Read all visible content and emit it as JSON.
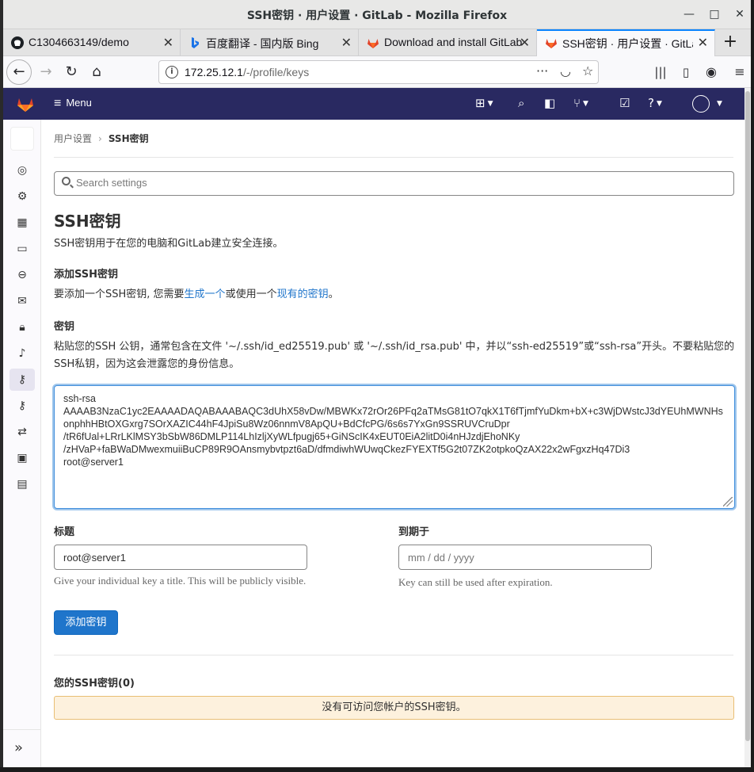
{
  "window": {
    "title": "SSH密钥 · 用户设置 · GitLab - Mozilla Firefox"
  },
  "tabs": [
    {
      "label": "C1304663149/demo",
      "icon": "github-icon"
    },
    {
      "label": "百度翻译 - 国内版 Bing",
      "icon": "bing-icon"
    },
    {
      "label": "Download and install GitLab",
      "icon": "gitlab-icon"
    },
    {
      "label": "SSH密钥 · 用户设置 · GitLab",
      "icon": "gitlab-icon"
    }
  ],
  "urlbar": {
    "host": "172.25.12.1",
    "path": "/-/profile/keys"
  },
  "header": {
    "menu_label": "Menu"
  },
  "breadcrumb": {
    "parent": "用户设置",
    "current": "SSH密钥"
  },
  "search": {
    "placeholder": "Search settings"
  },
  "page": {
    "title": "SSH密钥",
    "description": "SSH密钥用于在您的电脑和GitLab建立安全连接。",
    "add_heading": "添加SSH密钥",
    "add_text_pre": "要添加一个SSH密钥, 您需要",
    "add_link_generate": "生成一个",
    "add_text_mid": "或使用一个",
    "add_link_existing": "现有的密钥",
    "add_text_post": "。",
    "key_heading": "密钥",
    "key_help": "粘贴您的SSH 公钥，通常包含在文件 '~/.ssh/id_ed25519.pub' 或 '~/.ssh/id_rsa.pub' 中，并以“ssh-ed25519”或“ssh-rsa”开头。不要粘贴您的SSH私钥，因为这会泄露您的身份信息。",
    "key_value": "ssh-rsa\nAAAAB3NzaC1yc2EAAAADAQABAAABAQC3dUhX58vDw/MBWKx72rOr26PFq2aTMsG81tO7qkX1T6fTjmfYuDkm+bX+c3WjDWstcJ3dYEUhMWNHsonphhHBtOXGxrg7SOrXAZIC44hF4JpiSu8Wz06nnmV8ApQU+BdCfcPG/6s6s7YxGn9SSRUVCruDpr\n/tR6fUal+LRrLKlMSY3bSbW86DMLP114LhIzljXyWLfpugj65+GiNScIK4xEUT0EiA2litD0i4nHJzdjEhoNKy\n/zHVaP+faBWaDMwexmuiiBuCP89R9OAnsmybvtpzt6aD/dfmdiwhWUwqCkezFYEXTf5G2t07ZK2otpkoQzAX22x2wFgxzHq47Di3\nroot@server1",
    "title_label": "标题",
    "title_value": "root@server1",
    "title_help": "Give your individual key a title. This will be publicly visible.",
    "expires_label": "到期于",
    "expires_placeholder": "mm / dd / yyyy",
    "expires_help": "Key can still be used after expiration.",
    "add_button": "添加密钥",
    "your_keys_heading": "您的SSH密钥(0)",
    "no_keys_alert": "没有可访问您帐户的SSH密钥。"
  },
  "colors": {
    "header_bg": "#292961",
    "primary": "#1f75cb",
    "alert_bg": "#fdf1dd",
    "alert_border": "#e9be74"
  }
}
